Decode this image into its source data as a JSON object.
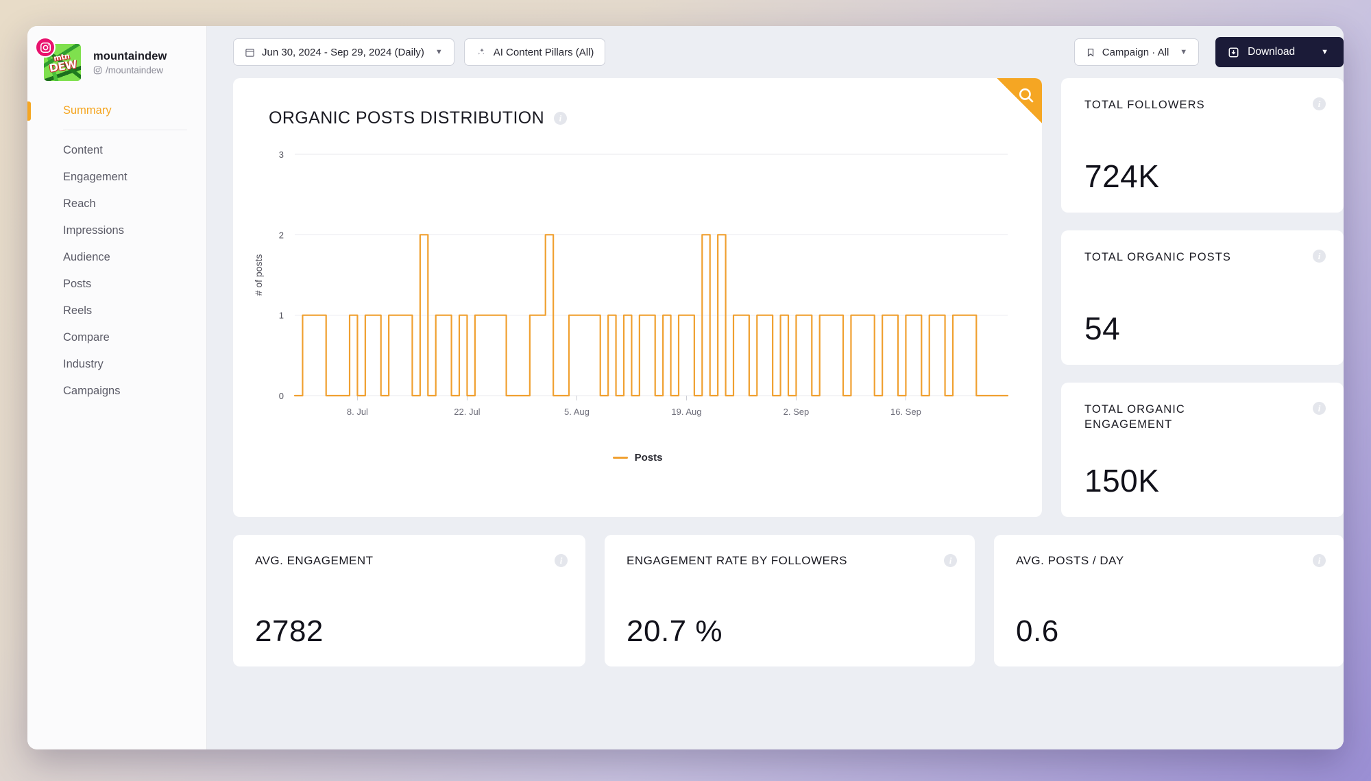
{
  "sidebar": {
    "profile": {
      "name": "mountaindew",
      "handle": "/mountaindew",
      "platform_icon": "instagram-icon",
      "avatar_text_small": "mtn",
      "avatar_text_big": "DEW"
    },
    "items": [
      {
        "label": "Summary",
        "active": true
      },
      {
        "label": "Content",
        "active": false
      },
      {
        "label": "Engagement",
        "active": false
      },
      {
        "label": "Reach",
        "active": false
      },
      {
        "label": "Impressions",
        "active": false
      },
      {
        "label": "Audience",
        "active": false
      },
      {
        "label": "Posts",
        "active": false
      },
      {
        "label": "Reels",
        "active": false
      },
      {
        "label": "Compare",
        "active": false
      },
      {
        "label": "Industry",
        "active": false
      },
      {
        "label": "Campaigns",
        "active": false
      }
    ]
  },
  "toolbar": {
    "date_range": "Jun 30, 2024 - Sep 29, 2024 (Daily)",
    "date_icon": "calendar-icon",
    "ai_pillars": "AI Content Pillars (All)",
    "ai_icon": "sparkle-icon",
    "campaign": "Campaign · All",
    "campaign_icon": "bookmark-icon",
    "download": "Download",
    "download_icon": "download-icon",
    "caret": "▼"
  },
  "chart_card": {
    "title": "ORGANIC POSTS DISTRIBUTION",
    "search_icon": "search-icon",
    "info_icon": "info-icon"
  },
  "kpis": [
    {
      "label": "TOTAL FOLLOWERS",
      "value": "724K"
    },
    {
      "label": "TOTAL ORGANIC POSTS",
      "value": "54"
    },
    {
      "label": "TOTAL ORGANIC ENGAGEMENT",
      "value": "150K"
    }
  ],
  "metrics": [
    {
      "label": "AVG. ENGAGEMENT",
      "value": "2782"
    },
    {
      "label": "ENGAGEMENT RATE BY FOLLOWERS",
      "value": "20.7 %"
    },
    {
      "label": "AVG. POSTS / DAY",
      "value": "0.6"
    }
  ],
  "chart_data": {
    "type": "line",
    "title": "ORGANIC POSTS DISTRIBUTION",
    "xlabel": "",
    "ylabel": "# of posts",
    "ylim": [
      0,
      3
    ],
    "yticks": [
      0,
      1,
      2,
      3
    ],
    "grid": true,
    "legend_position": "bottom",
    "line_color": "#f0a030",
    "step_style": true,
    "x_start": "2024-06-30",
    "x_end": "2024-09-29",
    "xtick_labels": [
      "8. Jul",
      "22. Jul",
      "5. Aug",
      "19. Aug",
      "2. Sep",
      "16. Sep"
    ],
    "xtick_indices": [
      8,
      22,
      36,
      50,
      64,
      78
    ],
    "series": [
      {
        "name": "Posts",
        "values": [
          0,
          1,
          1,
          1,
          0,
          0,
          0,
          1,
          0,
          1,
          1,
          0,
          1,
          1,
          1,
          0,
          2,
          0,
          1,
          1,
          0,
          1,
          0,
          1,
          1,
          1,
          1,
          0,
          0,
          0,
          1,
          1,
          2,
          0,
          0,
          1,
          1,
          1,
          1,
          0,
          1,
          0,
          1,
          0,
          1,
          1,
          0,
          1,
          0,
          1,
          1,
          0,
          2,
          0,
          2,
          0,
          1,
          1,
          0,
          1,
          1,
          0,
          1,
          0,
          1,
          1,
          0,
          1,
          1,
          1,
          0,
          1,
          1,
          1,
          0,
          1,
          1,
          0,
          1,
          1,
          0,
          1,
          1,
          0,
          1,
          1,
          1,
          0,
          0,
          0,
          0,
          0
        ]
      }
    ]
  }
}
